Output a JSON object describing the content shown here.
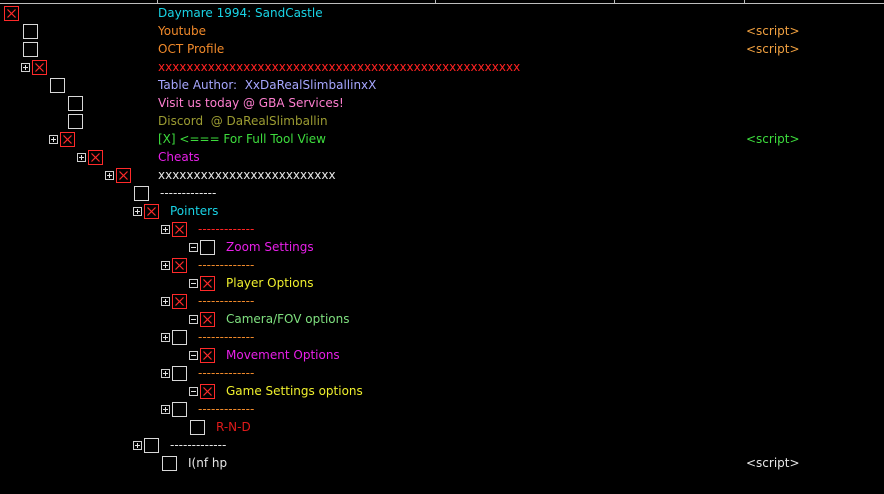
{
  "colors": {
    "cyan": "#19d4e6",
    "orange": "#f0892a",
    "red": "#ff2222",
    "lavender": "#a7a7ff",
    "pink": "#ff7fd0",
    "olive": "#9c9c32",
    "green": "#3ddc3d",
    "magenta": "#e81fe8",
    "white": "#e6e6e6",
    "yellow": "#f0f02d",
    "light_green": "#7fe07f",
    "dark_red": "#e01a1a",
    "script": "#f0a040"
  },
  "rows": [
    {
      "label": "Daymare 1994: SandCastle",
      "expander": null,
      "checked": true,
      "script": ""
    },
    {
      "label": "Youtube",
      "expander": null,
      "checked": false,
      "script": "<script>"
    },
    {
      "label": "OCT Profile",
      "expander": null,
      "checked": false,
      "script": "<script>"
    },
    {
      "label": "xxxxxxxxxxxxxxxxxxxxxxxxxxxxxxxxxxxxxxxxxxxxxxxxxxx",
      "expander": "plus",
      "checked": true,
      "script": ""
    },
    {
      "label": "Table Author:  XxDaRealSlimballinxX",
      "expander": null,
      "checked": false,
      "script": ""
    },
    {
      "label": "Visit us today @ GBA Services!",
      "expander": null,
      "checked": false,
      "script": ""
    },
    {
      "label": "Discord  @ DaRealSlimballin",
      "expander": null,
      "checked": false,
      "script": ""
    },
    {
      "label": "[X] <=== For Full Tool View",
      "expander": "plus",
      "checked": true,
      "script": "<script>"
    },
    {
      "label": "Cheats",
      "expander": "plus",
      "checked": true,
      "script": ""
    },
    {
      "label": "xxxxxxxxxxxxxxxxxxxxxxxxx",
      "expander": "plus",
      "checked": true,
      "script": ""
    },
    {
      "label": "-------------",
      "expander": null,
      "checked": false,
      "script": ""
    },
    {
      "label": "Pointers",
      "expander": "plus",
      "checked": true,
      "script": ""
    },
    {
      "label": "-------------",
      "expander": "plus",
      "checked": true,
      "script": ""
    },
    {
      "label": "Zoom Settings",
      "expander": "minus",
      "checked": false,
      "script": ""
    },
    {
      "label": "-------------",
      "expander": "plus",
      "checked": true,
      "script": ""
    },
    {
      "label": "Player Options",
      "expander": "minus",
      "checked": true,
      "script": ""
    },
    {
      "label": "-------------",
      "expander": "plus",
      "checked": true,
      "script": ""
    },
    {
      "label": "Camera/FOV options",
      "expander": "minus",
      "checked": true,
      "script": ""
    },
    {
      "label": "-------------",
      "expander": "plus",
      "checked": false,
      "script": ""
    },
    {
      "label": "Movement Options",
      "expander": "minus",
      "checked": true,
      "script": ""
    },
    {
      "label": "-------------",
      "expander": "plus",
      "checked": false,
      "script": ""
    },
    {
      "label": "Game Settings options",
      "expander": "minus",
      "checked": true,
      "script": ""
    },
    {
      "label": "-------------",
      "expander": "plus",
      "checked": false,
      "script": ""
    },
    {
      "label": "R-N-D",
      "expander": null,
      "checked": false,
      "script": ""
    },
    {
      "label": "-------------",
      "expander": "plus",
      "checked": false,
      "script": ""
    },
    {
      "label": "I(nf hp",
      "expander": null,
      "checked": false,
      "script": "<script>"
    }
  ]
}
